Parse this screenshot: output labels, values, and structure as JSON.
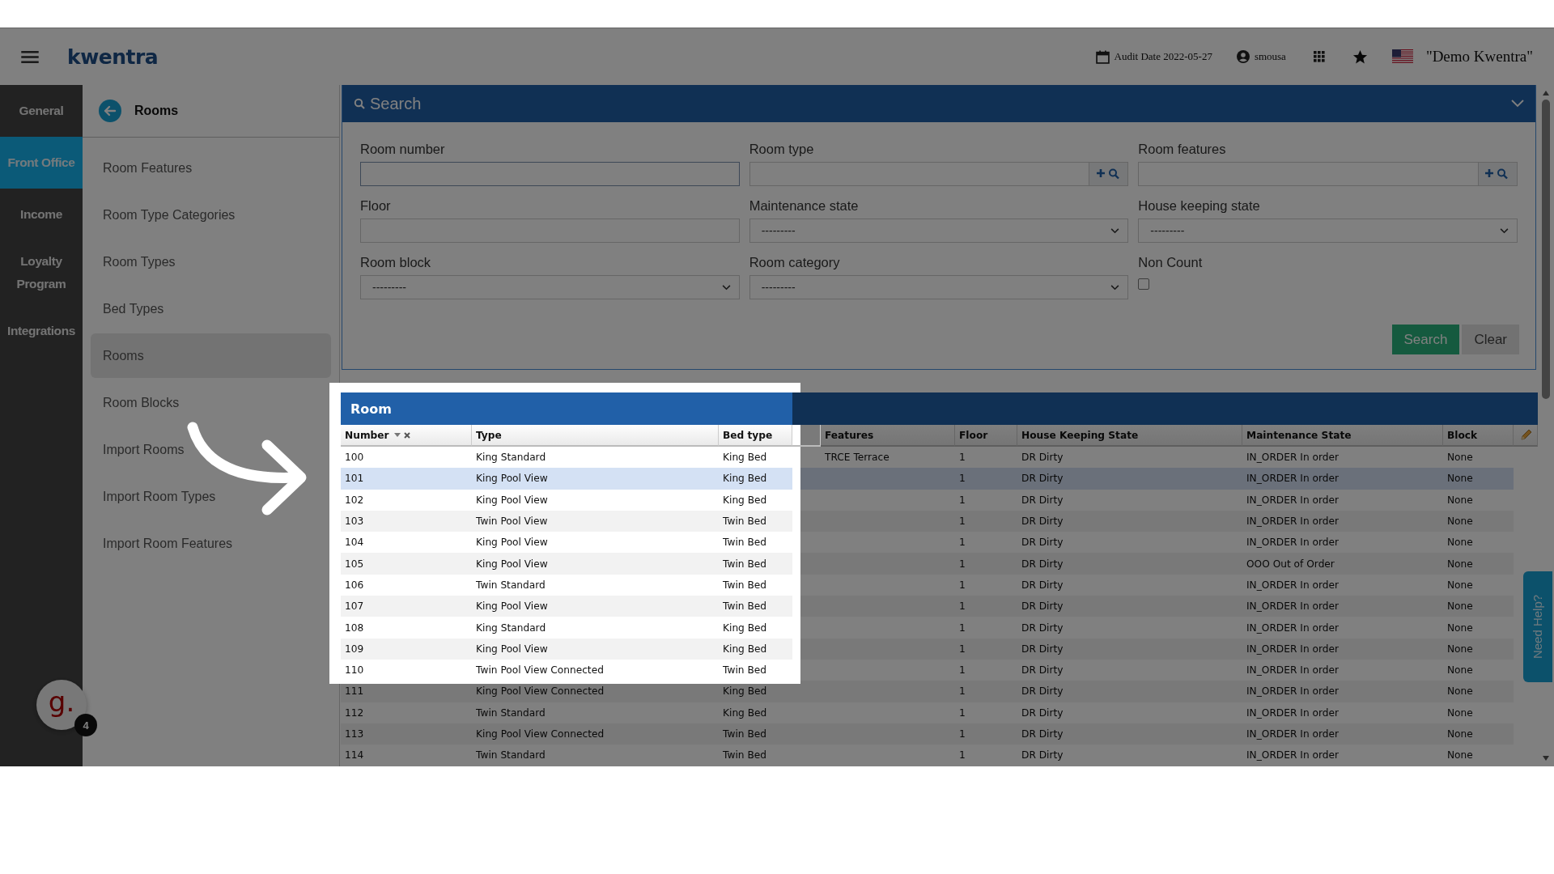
{
  "header": {
    "logo": "kwentra",
    "audit_date": "Audit Date 2022-05-27",
    "user": "smousa",
    "company": "\"Demo Kwentra\""
  },
  "sidebar": {
    "items": [
      {
        "label": "General",
        "selected": false
      },
      {
        "label": "Front Office",
        "selected": true
      },
      {
        "label": "Income",
        "selected": false
      },
      {
        "label": "Loyalty Program",
        "selected": false
      },
      {
        "label": "Integrations",
        "selected": false
      }
    ],
    "chat": {
      "logo": "g.",
      "badge": "4"
    }
  },
  "nav": {
    "title": "Rooms",
    "items": [
      {
        "label": "Room Features",
        "selected": false
      },
      {
        "label": "Room Type Categories",
        "selected": false
      },
      {
        "label": "Room Types",
        "selected": false
      },
      {
        "label": "Bed Types",
        "selected": false
      },
      {
        "label": "Rooms",
        "selected": true
      },
      {
        "label": "Room Blocks",
        "selected": false
      },
      {
        "label": "Import Rooms",
        "selected": false
      },
      {
        "label": "Import Room Types",
        "selected": false
      },
      {
        "label": "Import Room Features",
        "selected": false
      }
    ]
  },
  "search": {
    "title": "Search",
    "fields": [
      {
        "label": "Room number",
        "kind": "text"
      },
      {
        "label": "Room type",
        "kind": "lookup"
      },
      {
        "label": "Room features",
        "kind": "lookup"
      },
      {
        "label": "Floor",
        "kind": "text"
      },
      {
        "label": "Maintenance state",
        "kind": "select",
        "value": "---------"
      },
      {
        "label": "House keeping state",
        "kind": "select",
        "value": "---------"
      },
      {
        "label": "Room block",
        "kind": "select",
        "value": "---------"
      },
      {
        "label": "Room category",
        "kind": "select",
        "value": "---------"
      },
      {
        "label": "Non Count",
        "kind": "checkbox",
        "checked": false
      }
    ],
    "buttons": [
      {
        "label": "Search",
        "kind": "primary"
      },
      {
        "label": "Clear",
        "kind": "secondary"
      }
    ]
  },
  "table": {
    "title": "Room",
    "columns": [
      {
        "label": "Number",
        "highlighted": true,
        "sorted": true
      },
      {
        "label": "Type",
        "highlighted": true,
        "sorted": false
      },
      {
        "label": "Bed type",
        "highlighted": true,
        "sorted": false
      },
      {
        "label": "Features",
        "highlighted": false,
        "sorted": false
      },
      {
        "label": "Floor",
        "highlighted": false,
        "sorted": false
      },
      {
        "label": "House Keeping State",
        "highlighted": false,
        "sorted": false
      },
      {
        "label": "Maintenance State",
        "highlighted": false,
        "sorted": false
      },
      {
        "label": "Block",
        "highlighted": false,
        "sorted": false
      }
    ],
    "rows": [
      {
        "selected": false,
        "highlighted": true,
        "cells": [
          "100",
          "King Standard",
          "King Bed",
          "TRCE Terrace",
          "1",
          "DR Dirty",
          "IN_ORDER In order",
          "None"
        ]
      },
      {
        "selected": true,
        "highlighted": true,
        "cells": [
          "101",
          "King Pool View",
          "King Bed",
          null,
          "1",
          "DR Dirty",
          "IN_ORDER In order",
          "None"
        ]
      },
      {
        "selected": false,
        "highlighted": true,
        "cells": [
          "102",
          "King Pool View",
          "King Bed",
          null,
          "1",
          "DR Dirty",
          "IN_ORDER In order",
          "None"
        ]
      },
      {
        "selected": false,
        "highlighted": true,
        "cells": [
          "103",
          "Twin Pool View",
          "Twin Bed",
          null,
          "1",
          "DR Dirty",
          "IN_ORDER In order",
          "None"
        ]
      },
      {
        "selected": false,
        "highlighted": true,
        "cells": [
          "104",
          "King Pool View",
          "Twin Bed",
          null,
          "1",
          "DR Dirty",
          "IN_ORDER In order",
          "None"
        ]
      },
      {
        "selected": false,
        "highlighted": true,
        "cells": [
          "105",
          "King Pool View",
          "Twin Bed",
          null,
          "1",
          "DR Dirty",
          "OOO Out of Order",
          "None"
        ]
      },
      {
        "selected": false,
        "highlighted": true,
        "cells": [
          "106",
          "Twin Standard",
          "Twin Bed",
          null,
          "1",
          "DR Dirty",
          "IN_ORDER In order",
          "None"
        ]
      },
      {
        "selected": false,
        "highlighted": true,
        "cells": [
          "107",
          "King Pool View",
          "Twin Bed",
          null,
          "1",
          "DR Dirty",
          "IN_ORDER In order",
          "None"
        ]
      },
      {
        "selected": false,
        "highlighted": true,
        "cells": [
          "108",
          "King Standard",
          "King Bed",
          null,
          "1",
          "DR Dirty",
          "IN_ORDER In order",
          "None"
        ]
      },
      {
        "selected": false,
        "highlighted": true,
        "cells": [
          "109",
          "King Pool View",
          "King Bed",
          null,
          "1",
          "DR Dirty",
          "IN_ORDER In order",
          "None"
        ]
      },
      {
        "selected": false,
        "highlighted": true,
        "cells": [
          "110",
          "Twin Pool View Connected",
          "Twin Bed",
          null,
          "1",
          "DR Dirty",
          "IN_ORDER In order",
          "None"
        ]
      },
      {
        "selected": false,
        "highlighted": false,
        "cells": [
          "111",
          "King Pool View Connected",
          "King Bed",
          null,
          "1",
          "DR Dirty",
          "IN_ORDER In order",
          "None"
        ]
      },
      {
        "selected": false,
        "highlighted": false,
        "cells": [
          "112",
          "Twin Standard",
          "King Bed",
          null,
          "1",
          "DR Dirty",
          "IN_ORDER In order",
          "None"
        ]
      },
      {
        "selected": false,
        "highlighted": false,
        "cells": [
          "113",
          "King Pool View Connected",
          "Twin Bed",
          null,
          "1",
          "DR Dirty",
          "IN_ORDER In order",
          "None"
        ]
      },
      {
        "selected": false,
        "highlighted": false,
        "cells": [
          "114",
          "Twin Standard",
          "Twin Bed",
          null,
          "1",
          "DR Dirty",
          "IN_ORDER In order",
          "None"
        ]
      }
    ]
  },
  "help_tab": "Need Help?"
}
